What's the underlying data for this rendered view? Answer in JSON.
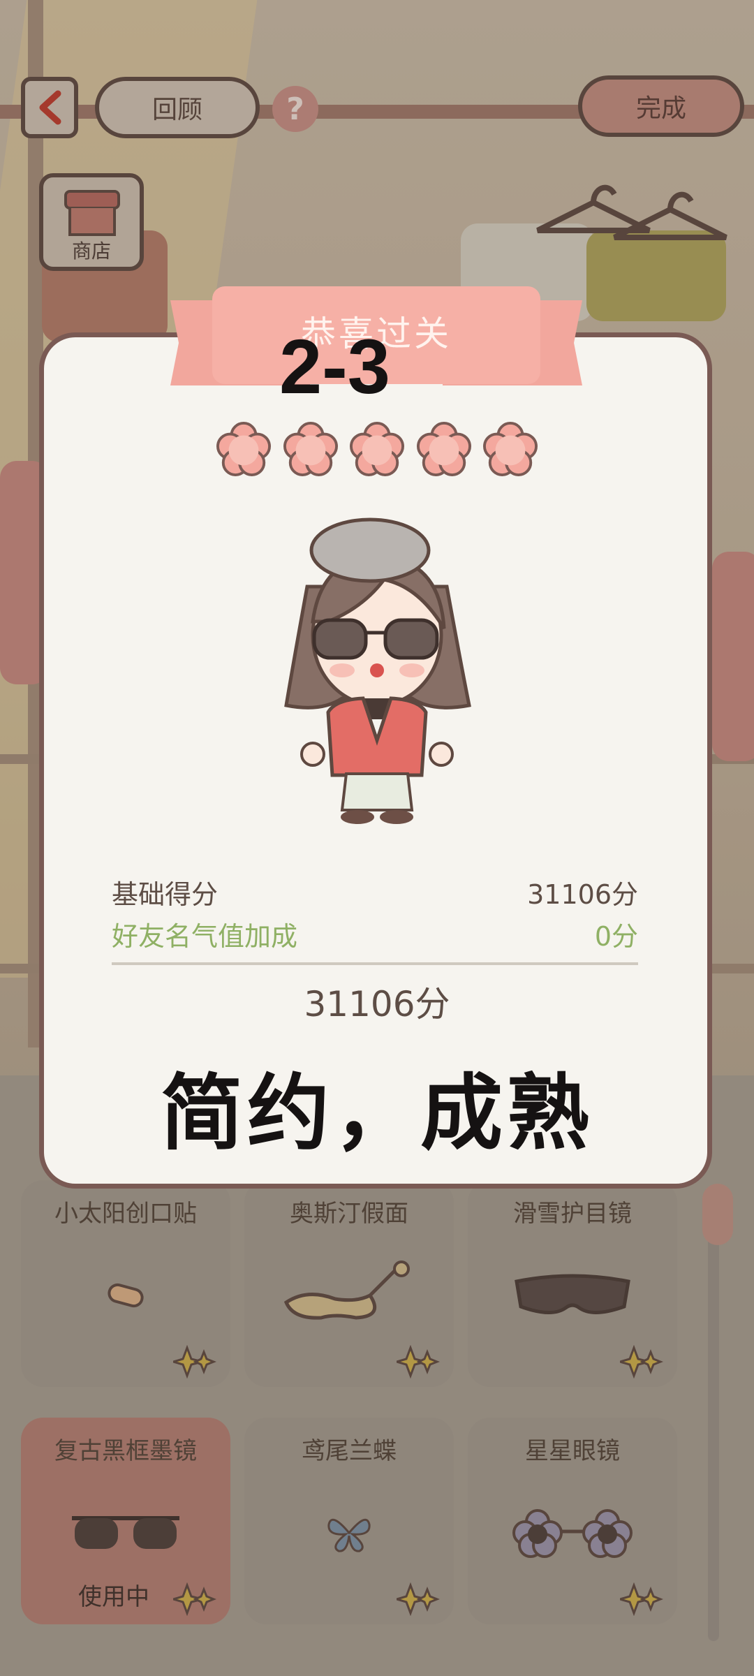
{
  "topbar": {
    "review_label": "回顾",
    "help_label": "?",
    "done_label": "完成",
    "shop_label": "商店"
  },
  "modal": {
    "ribbon_title": "恭喜过关",
    "level": "2-3",
    "stars_filled": 5,
    "stars_total": 5,
    "base_score_label": "基础得分",
    "base_score_value": "31106分",
    "bonus_label": "好友名气值加成",
    "bonus_value": "0分",
    "total_score": "31106分",
    "style_remark": "简约，成熟"
  },
  "items": [
    {
      "name": "小太阳创口贴",
      "icon": "bandage-icon",
      "status": ""
    },
    {
      "name": "奥斯汀假面",
      "icon": "mask-icon",
      "status": ""
    },
    {
      "name": "滑雪护目镜",
      "icon": "ski-goggles-icon",
      "status": ""
    },
    {
      "name": "复古黑框墨镜",
      "icon": "sunglasses-icon",
      "status": "使用中"
    },
    {
      "name": "鸢尾兰蝶",
      "icon": "butterfly-icon",
      "status": ""
    },
    {
      "name": "星星眼镜",
      "icon": "flower-glasses-icon",
      "status": ""
    }
  ],
  "colors": {
    "accent": "#f6b0a6",
    "panel": "#f6f4ef",
    "border": "#7a5a54",
    "bonus_green": "#8fb064"
  }
}
